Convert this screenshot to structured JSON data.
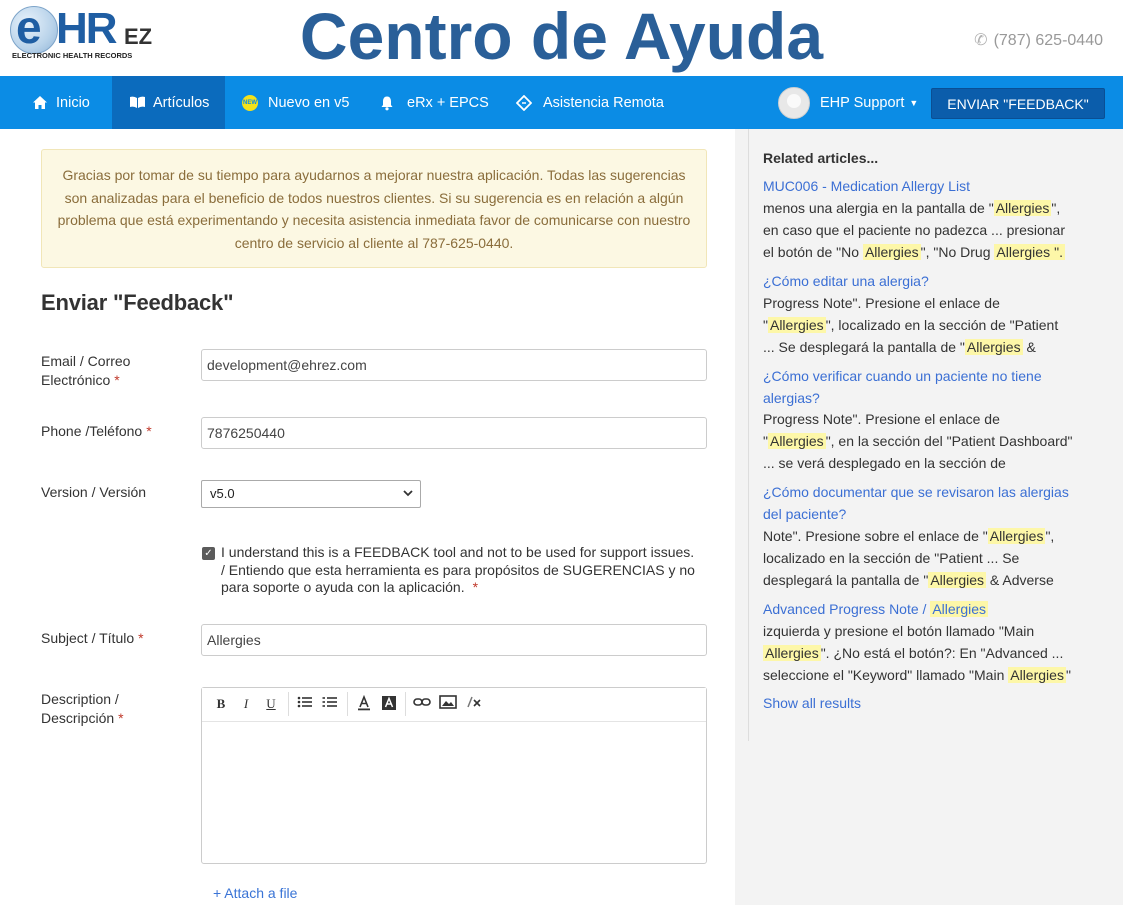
{
  "header": {
    "logo": {
      "e": "e",
      "hr": "HR",
      "ez": "EZ",
      "subtitle": "ELECTRONIC HEALTH RECORDS"
    },
    "title": "Centro de Ayuda",
    "phone": "(787) 625-0440",
    "phone_icon": "phone-icon"
  },
  "nav": {
    "items": [
      {
        "label": "Inicio",
        "icon": "home-icon",
        "active": false
      },
      {
        "label": "Artículos",
        "icon": "book-icon",
        "active": true
      },
      {
        "label": "Nuevo en v5",
        "icon": "new-badge-icon",
        "badge": "NEW",
        "active": false
      },
      {
        "label": "eRx + EPCS",
        "icon": "bell-icon",
        "active": false
      },
      {
        "label": "Asistencia Remota",
        "icon": "ticket-icon",
        "active": false
      }
    ],
    "user": "EHP Support",
    "feedback_button": "ENVIAR \"FEEDBACK\""
  },
  "alert": {
    "text": "Gracias por tomar de su tiempo para ayudarnos a mejorar nuestra aplicación. Todas las sugerencias son analizadas para el beneficio de todos nuestros clientes. Si su sugerencia es en relación a algún problema que está experimentando y necesita asistencia inmediata favor de comunicarse con nuestro centro de servicio al cliente al 787-625-0440."
  },
  "form": {
    "title": "Enviar \"Feedback\"",
    "email": {
      "label_line1": "Email / Correo",
      "label_line2": "Electrónico",
      "value": "development@ehrez.com"
    },
    "phone": {
      "label": "Phone /Teléfono",
      "value": "7876250440"
    },
    "version": {
      "label": "Version / Versión",
      "value": "v5.0"
    },
    "acknowledge": {
      "checked": true,
      "text": "I understand this is a FEEDBACK tool and not to be used for support issues. / Entiendo que esta herramienta es para propósitos de SUGERENCIAS y no para soporte o ayuda con la aplicación."
    },
    "subject": {
      "label": "Subject / Título",
      "value": "Allergies"
    },
    "description": {
      "label_line1": "Description /",
      "label_line2": "Descripción",
      "value": ""
    },
    "required_mark": "*",
    "attach_label": "+ Attach a file"
  },
  "editor_toolbar": {
    "bold": "B",
    "italic": "I",
    "underline": "U"
  },
  "related": {
    "title": "Related articles...",
    "show_all": "Show all results",
    "articles": [
      {
        "link": "MUC006 - Medication Allergy List",
        "snippet": [
          [
            "menos una alergia en la pantalla de \"",
            "Allergies",
            "\","
          ],
          [
            "en caso que el paciente no padezca ... presionar"
          ],
          [
            "el botón de \"No ",
            "Allergies",
            "\",  \"No Drug ",
            "Allergies",
            "\"."
          ]
        ]
      },
      {
        "link": "¿Cómo editar una alergia?",
        "snippet": [
          [
            "Progress Note\".  Presione el enlace de"
          ],
          [
            "\"",
            "Allergies",
            "\", localizado en la sección de \"Patient"
          ],
          [
            "... Se desplegará la pantalla de \"",
            "Allergies",
            " &"
          ]
        ]
      },
      {
        "link_line1": "¿Cómo verificar cuando un paciente no tiene",
        "link_line2": "alergias?",
        "snippet": [
          [
            "Progress Note\". Presione el enlace de"
          ],
          [
            "\"",
            "Allergies",
            "\", en la sección del \"Patient Dashboard\""
          ],
          [
            "... se verá desplegado en la sección de"
          ]
        ]
      },
      {
        "link_line1": "¿Cómo documentar que se revisaron las alergias",
        "link_line2": "del paciente?",
        "snippet": [
          [
            "Note\".  Presione sobre el enlace de \"",
            "Allergies",
            "\","
          ],
          [
            "localizado en la sección de \"Patient ... Se"
          ],
          [
            "desplegará la pantalla de \"",
            "Allergies",
            " & Adverse"
          ]
        ]
      },
      {
        "link_pre": "Advanced Progress Note / ",
        "link_hl": "Allergies",
        "snippet": [
          [
            "izquierda y presione el botón llamado \"Main"
          ],
          [
            "",
            "Allergies",
            "\".  ¿No está el botón?: En \"Advanced ..."
          ],
          [
            "seleccione el \"Keyword\" llamado \"Main ",
            "Allergies",
            "\""
          ]
        ]
      }
    ]
  }
}
